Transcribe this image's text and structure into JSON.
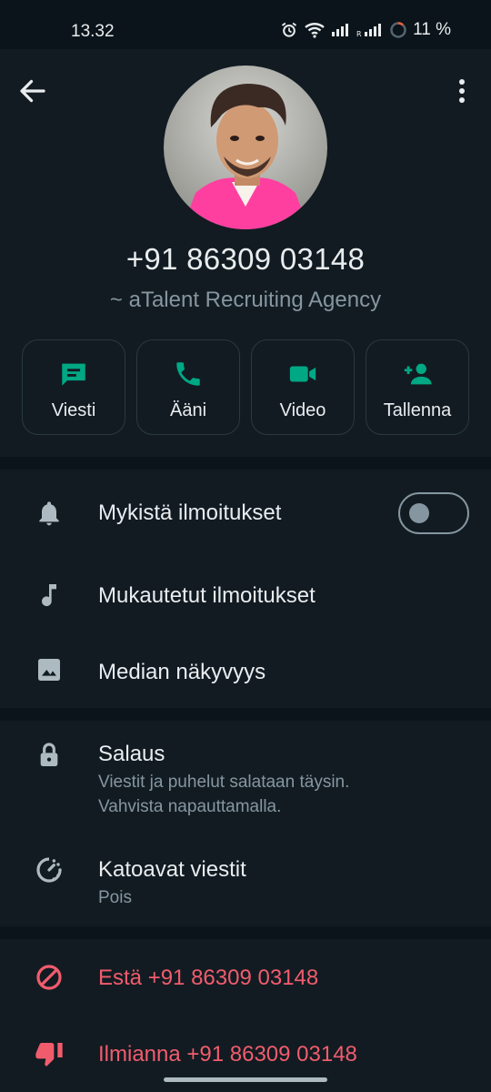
{
  "status_bar": {
    "time": "13.32",
    "battery_percent": "11 %",
    "icons": [
      "alarm-icon",
      "wifi-icon",
      "signal-icon",
      "roaming-signal-icon",
      "battery-ring-icon"
    ]
  },
  "header": {
    "back_icon": "arrow-left-icon",
    "menu_icon": "more-vert-icon",
    "phone_number": "+91 86309 03148",
    "subtitle": "~ aTalent Recruiting Agency"
  },
  "actions": [
    {
      "label": "Viesti",
      "icon": "message-icon"
    },
    {
      "label": "Ääni",
      "icon": "phone-icon"
    },
    {
      "label": "Video",
      "icon": "video-icon"
    },
    {
      "label": "Tallenna",
      "icon": "add-contact-icon"
    }
  ],
  "settings": {
    "mute": {
      "label": "Mykistä ilmoitukset",
      "icon": "bell-icon",
      "enabled": false
    },
    "custom": {
      "label": "Mukautetut ilmoitukset",
      "icon": "music-note-icon"
    },
    "media": {
      "label": "Median näkyvyys",
      "icon": "image-icon"
    }
  },
  "privacy": {
    "encryption": {
      "label": "Salaus",
      "desc_line1": "Viestit ja puhelut salataan täysin.",
      "desc_line2": "Vahvista napauttamalla.",
      "icon": "lock-icon"
    },
    "disappearing": {
      "label": "Katoavat viestit",
      "value": "Pois",
      "icon": "timer-icon"
    }
  },
  "danger": {
    "block": {
      "label": "Estä +91 86309 03148",
      "icon": "block-icon"
    },
    "report": {
      "label": "Ilmianna +91 86309 03148",
      "icon": "thumbs-down-icon"
    }
  },
  "colors": {
    "accent": "#00a884",
    "danger": "#f15c6d",
    "background": "#121b22",
    "divider": "#0b141a"
  }
}
